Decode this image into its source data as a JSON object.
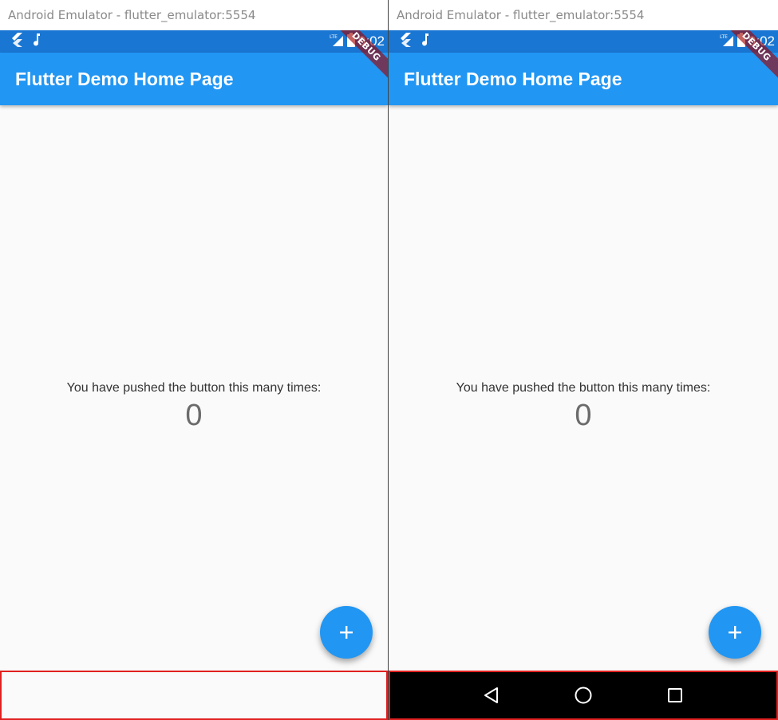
{
  "windows": [
    {
      "title": "Android Emulator - flutter_emulator:5554",
      "status_time": "9:02",
      "debug_label": "DEBUG",
      "app_title": "Flutter Demo Home Page",
      "counter_label": "You have pushed the button this many times:",
      "counter_value": "0",
      "fab_symbol": "+",
      "nav_bar_visible": false
    },
    {
      "title": "Android Emulator - flutter_emulator:5554",
      "status_time": "9:02",
      "debug_label": "DEBUG",
      "app_title": "Flutter Demo Home Page",
      "counter_label": "You have pushed the button this many times:",
      "counter_value": "0",
      "fab_symbol": "+",
      "nav_bar_visible": true,
      "nav_buttons": [
        "back-icon",
        "home-icon",
        "recents-icon"
      ]
    }
  ],
  "colors": {
    "status_bar": "#1976d2",
    "app_bar": "#2196f3",
    "fab": "#2196f3",
    "highlight_border": "#e02020",
    "nav_bar": "#000000",
    "page_background": "#fafafa"
  },
  "icons": {
    "status_left": [
      "flutter-logo-icon",
      "music-note-icon"
    ],
    "status_right": [
      "lte-signal-icon",
      "battery-icon"
    ],
    "fab": "plus-icon"
  }
}
